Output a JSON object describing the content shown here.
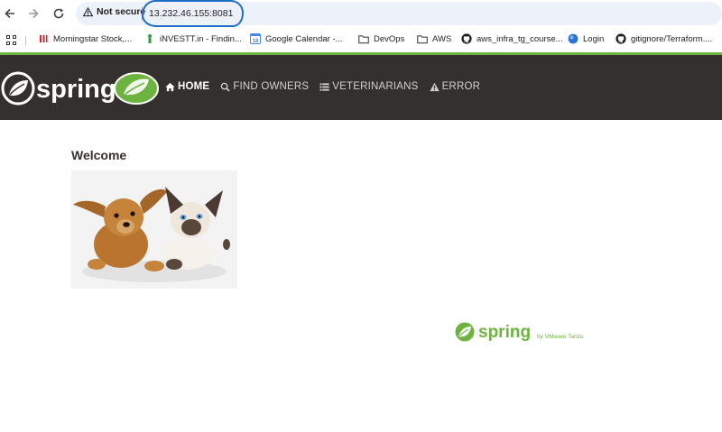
{
  "browser": {
    "security_label": "Not secure",
    "url": "13.232.46.155:8081"
  },
  "bookmarks": [
    {
      "label": "Morningstar Stock,...",
      "icon": "morningstar-icon"
    },
    {
      "label": "iNVESTT.in - Findin...",
      "icon": "investt-icon"
    },
    {
      "label": "Google Calendar -...",
      "icon": "calendar-icon"
    },
    {
      "label": "DevOps",
      "icon": "folder-icon"
    },
    {
      "label": "AWS",
      "icon": "folder-icon"
    },
    {
      "label": "aws_infra_tg_course...",
      "icon": "github-icon"
    },
    {
      "label": "Login",
      "icon": "globe-icon"
    },
    {
      "label": "gitignore/Terraform....",
      "icon": "github-icon"
    }
  ],
  "calendar_day": "18",
  "navbar": {
    "logo_text": "spring",
    "links": [
      {
        "label": "HOME",
        "icon": "home-icon",
        "active": true
      },
      {
        "label": "FIND OWNERS",
        "icon": "search-icon",
        "active": false
      },
      {
        "label": "VETERINARIANS",
        "icon": "list-icon",
        "active": false
      },
      {
        "label": "ERROR",
        "icon": "warning-icon",
        "active": false
      }
    ]
  },
  "main": {
    "heading": "Welcome"
  },
  "footer": {
    "brand": "spring",
    "tagline": "by VMware Tanzu"
  },
  "colors": {
    "navbar_bg": "#34302d",
    "spring_green": "#6db33f",
    "url_highlight": "#1f6fc9"
  }
}
